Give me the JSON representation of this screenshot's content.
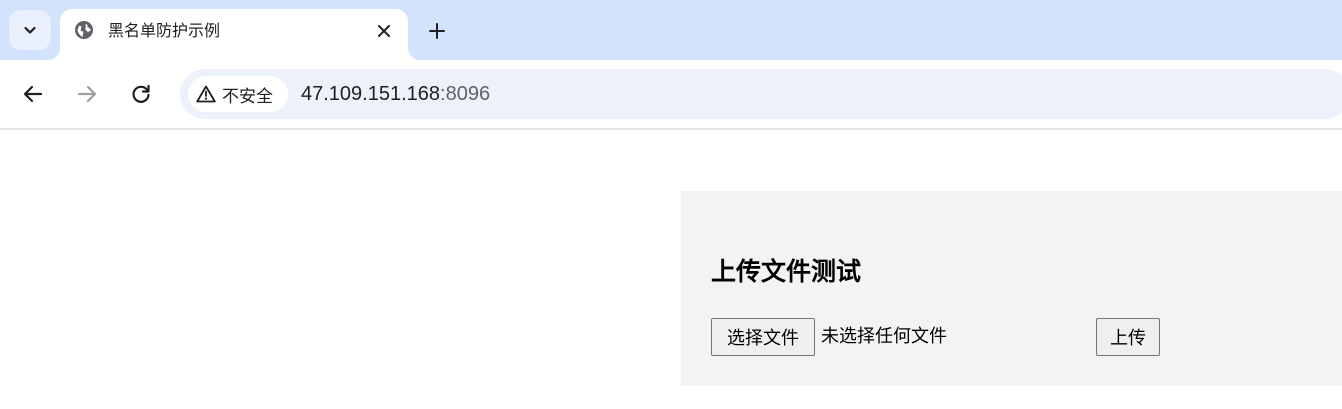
{
  "browser": {
    "tab": {
      "title": "黑名单防护示例",
      "favicon": "globe-icon",
      "close_icon": "close-icon"
    },
    "new_tab_icon": "plus-icon",
    "tab_search_icon": "chevron-down-icon",
    "nav": {
      "back_icon": "arrow-left-icon",
      "forward_icon": "arrow-right-icon",
      "reload_icon": "reload-icon"
    },
    "omnibox": {
      "security_label": "不安全",
      "security_icon": "warning-triangle-icon",
      "url_host": "47.109.151.168",
      "url_port": ":8096"
    },
    "colors": {
      "tabstrip_bg": "#d3e3fd",
      "omnibox_bg": "#edf2fa",
      "panel_bg": "#f3f3f3"
    }
  },
  "page": {
    "upload": {
      "title": "上传文件测试",
      "choose_file_label": "选择文件",
      "file_status": "未选择任何文件",
      "submit_label": "上传"
    }
  }
}
